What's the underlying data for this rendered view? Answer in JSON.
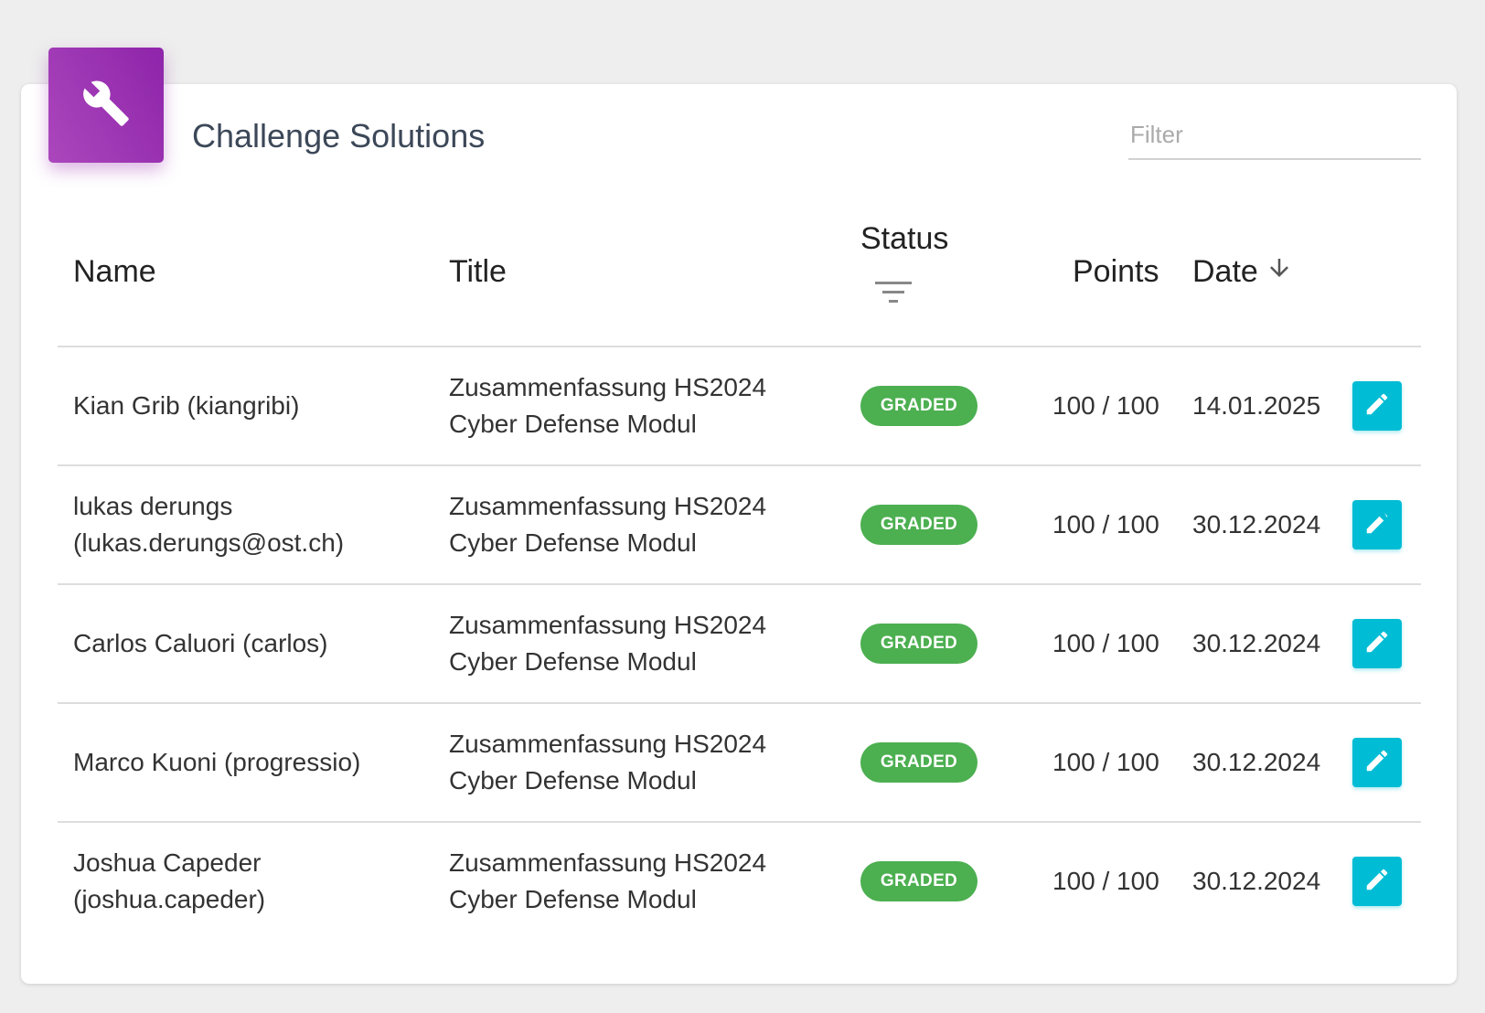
{
  "header": {
    "icon": "wrench-icon",
    "title": "Challenge Solutions",
    "filter_placeholder": "Filter"
  },
  "table": {
    "columns": {
      "name": "Name",
      "title": "Title",
      "status": "Status",
      "points": "Points",
      "date": "Date"
    },
    "sort": {
      "column": "Date",
      "direction": "descending",
      "icon": "arrow-down-icon"
    },
    "status_filter_icon": "filter-list-icon",
    "rows": [
      {
        "name_line1": "Kian Grib (kiangribi)",
        "name_line2": "",
        "title_line1": "Zusammenfassung HS2024",
        "title_line2": "Cyber Defense Modul",
        "status": "GRADED",
        "points": "100 / 100",
        "date": "14.01.2025"
      },
      {
        "name_line1": "lukas derungs",
        "name_line2": "(lukas.derungs@ost.ch)",
        "title_line1": "Zusammenfassung HS2024",
        "title_line2": "Cyber Defense Modul",
        "status": "GRADED",
        "points": "100 / 100",
        "date": "30.12.2024"
      },
      {
        "name_line1": "Carlos Caluori (carlos)",
        "name_line2": "",
        "title_line1": "Zusammenfassung HS2024",
        "title_line2": "Cyber Defense Modul",
        "status": "GRADED",
        "points": "100 / 100",
        "date": "30.12.2024"
      },
      {
        "name_line1": "Marco Kuoni (progressio)",
        "name_line2": "",
        "title_line1": "Zusammenfassung HS2024",
        "title_line2": "Cyber Defense Modul",
        "status": "GRADED",
        "points": "100 / 100",
        "date": "30.12.2024"
      },
      {
        "name_line1": "Joshua Capeder",
        "name_line2": "(joshua.capeder)",
        "title_line1": "Zusammenfassung HS2024",
        "title_line2": "Cyber Defense Modul",
        "status": "GRADED",
        "points": "100 / 100",
        "date": "30.12.2024"
      }
    ],
    "row_action_icon": "pencil-icon"
  },
  "colors": {
    "header_gradient_start": "#ab47bc",
    "header_gradient_end": "#8e24aa",
    "graded_badge": "#4caf50",
    "edit_button": "#00bcd4",
    "background": "#eeeeee"
  }
}
